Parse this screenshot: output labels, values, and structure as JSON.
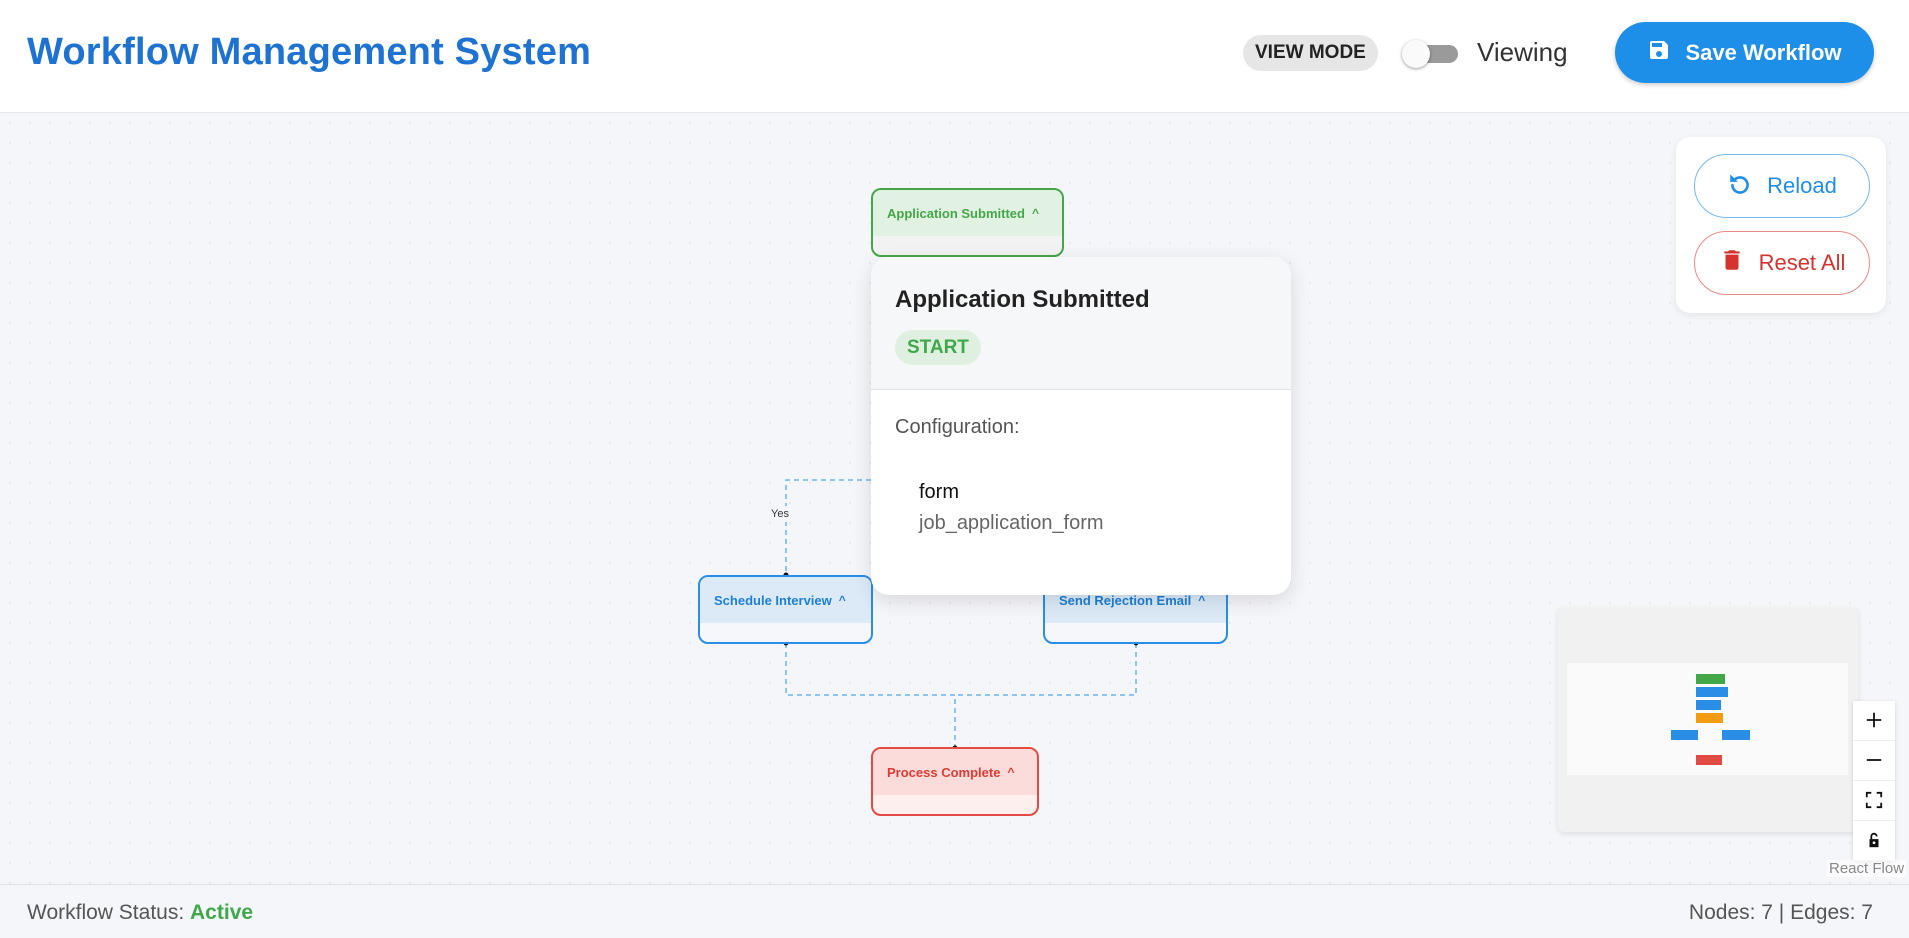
{
  "header": {
    "title": "Workflow Management System",
    "mode_chip": "VIEW MODE",
    "mode_label": "Viewing",
    "save_label": "Save Workflow"
  },
  "nodes": {
    "application_submitted": "Application Submitted",
    "schedule_interview": "Schedule Interview",
    "send_rejection_email": "Send Rejection Email",
    "process_complete": "Process Complete"
  },
  "edge_labels": {
    "yes": "Yes"
  },
  "popover": {
    "title": "Application Submitted",
    "type": "START",
    "config_label": "Configuration:",
    "config_key": "form",
    "config_value": "job_application_form"
  },
  "side_panel": {
    "reload_label": "Reload",
    "reset_label": "Reset All"
  },
  "attribution": "React Flow",
  "footer": {
    "status_label": "Workflow Status:",
    "status_value": "Active",
    "counts": "Nodes: 7 | Edges: 7"
  },
  "colors": {
    "primary": "#1e8fe8",
    "start": "#43a747",
    "task": "#2a8ee6",
    "decision": "#f39c12",
    "end": "#e24b43"
  }
}
